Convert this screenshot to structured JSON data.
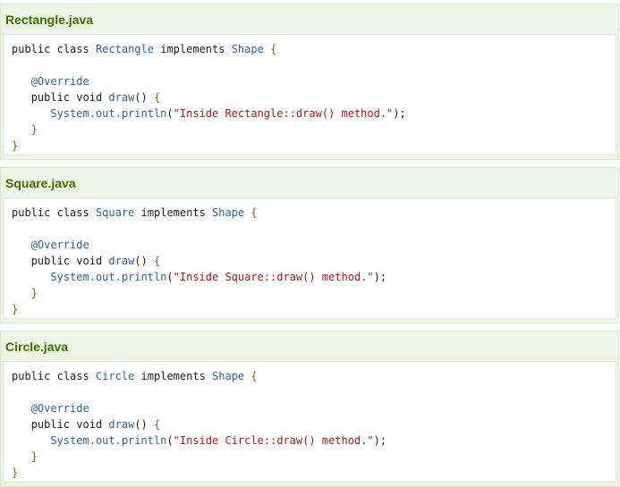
{
  "files": [
    {
      "title": "Rectangle.java",
      "class_name": "Rectangle",
      "message": "\"Inside Rectangle::draw() method.\""
    },
    {
      "title": "Square.java",
      "class_name": "Square",
      "message": "\"Inside Square::draw() method.\""
    },
    {
      "title": "Circle.java",
      "class_name": "Circle",
      "message": "\"Inside Circle::draw() method.\""
    }
  ],
  "code": {
    "public": "public",
    "class": "class",
    "implements": "implements",
    "interface_name": "Shape",
    "open_brace": "{",
    "close_brace": "}",
    "annotation": "@Override",
    "void": "void",
    "method_name": "draw",
    "parens": "()",
    "println_call": "System.out.println",
    "open_paren": "(",
    "close_stmt": ");"
  }
}
